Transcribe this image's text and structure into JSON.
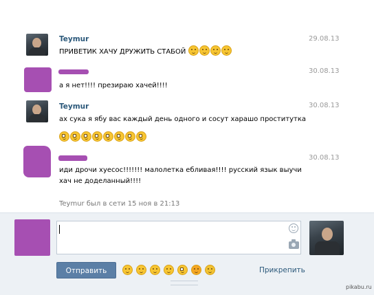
{
  "messages": [
    {
      "author": "Teymur",
      "date": "29.08.13",
      "text": "ПРИВЕТИК ХАЧУ ДРУЖИТЬ СТАБОЙ",
      "emoji_count": 4,
      "emoji": "relieved-emoji"
    },
    {
      "author": "",
      "date": "30.08.13",
      "text": "а я нет!!!! презираю хачей!!!!"
    },
    {
      "author": "Teymur",
      "date": "30.08.13",
      "text": "ах сука я ябу вас каждый день одного и сосут харашо проститутка",
      "emoji_count": 8,
      "emoji": "flushed-emoji"
    },
    {
      "author": "",
      "date": "30.08.13",
      "text_lines": [
        "иди дрочи хуесос!!!!!!! малолетка ебливая!!!! русский язык выучи",
        "хач не доделанный!!!!"
      ]
    }
  ],
  "status": "Teymur был в сети 15 ноя в 21:13",
  "compose": {
    "value": "",
    "send_label": "Отправить",
    "attach_label": "Прикрепить"
  },
  "emoji_bar": [
    "grin-emoji",
    "laughing-emoji",
    "kissing-emoji",
    "neutral-emoji",
    "flushed-emoji",
    "heart-eyes-emoji",
    "scream-emoji"
  ],
  "watermark": "pikabu.ru"
}
